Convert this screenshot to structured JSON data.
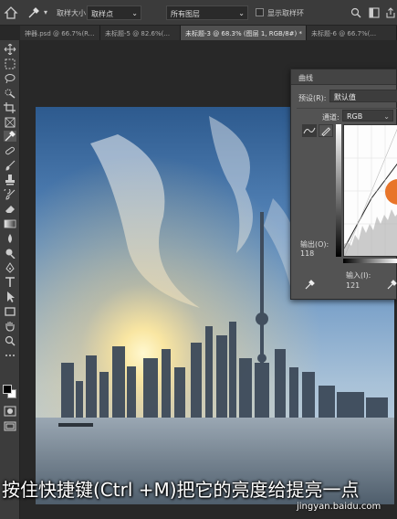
{
  "options_bar": {
    "sample_size_label": "取样大小：",
    "sample_size_value": "取样点",
    "sample_layer_value": "所有图层",
    "show_ring_label": "显示取样环"
  },
  "tabs": [
    {
      "label": "神器.psd @ 66.7%(R..."
    },
    {
      "label": "未标题-5 @ 82.6%(..."
    },
    {
      "label": "未标题-3 @ 68.3% (图层 1, RGB/8#) *",
      "active": true
    },
    {
      "label": "未标题-6 @ 66.7%(..."
    }
  ],
  "toolbar": {
    "icons": [
      "move-tool-icon",
      "marquee-tool-icon",
      "lasso-tool-icon",
      "quick-select-tool-icon",
      "crop-tool-icon",
      "frame-tool-icon",
      "eyedropper-tool-icon",
      "healing-brush-icon",
      "brush-tool-icon",
      "clone-stamp-icon",
      "history-brush-icon",
      "eraser-tool-icon",
      "gradient-tool-icon",
      "blur-tool-icon",
      "dodge-tool-icon",
      "pen-tool-icon",
      "type-tool-icon",
      "path-select-icon",
      "rectangle-tool-icon",
      "hand-tool-icon",
      "zoom-tool-icon"
    ]
  },
  "curves_dialog": {
    "title": "曲线",
    "preset_label": "预设(R):",
    "preset_value": "默认值",
    "channel_label": "通道:",
    "channel_value": "RGB",
    "output_label": "输出(O):",
    "output_value": "118",
    "input_label": "输入(I):",
    "input_value": "121"
  },
  "caption": "按住快捷键(Ctrl +M)把它的亮度给提亮一点",
  "watermark": "jingyan.baidu.com",
  "colors": {
    "accent": "#e8752a",
    "panel_bg": "#535353",
    "toolbar_bg": "#3c3c3c"
  }
}
